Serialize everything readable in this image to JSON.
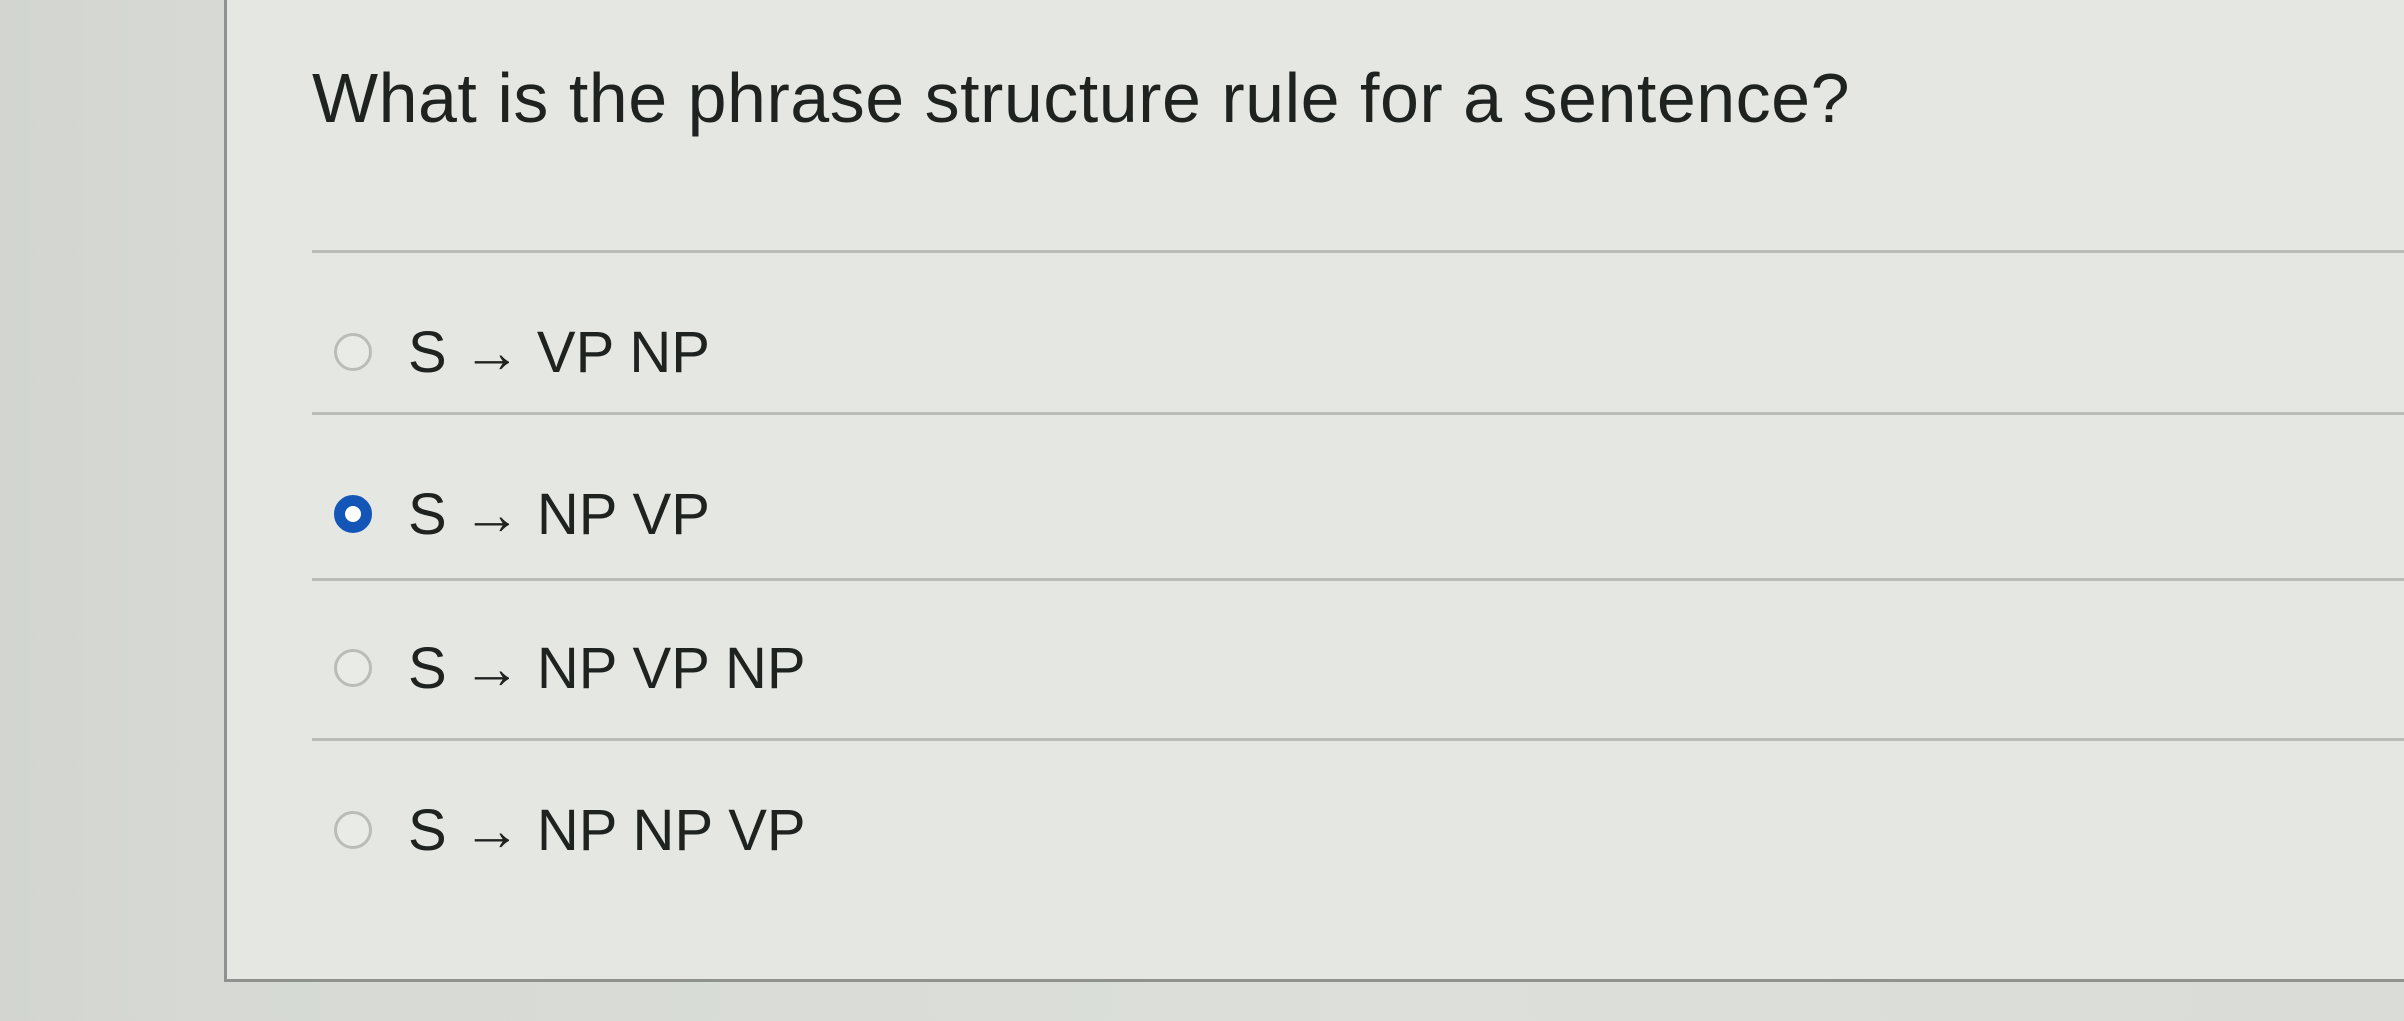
{
  "question": {
    "text": "What is the phrase structure rule for a sentence?"
  },
  "options": [
    {
      "label": "S → VP NP",
      "selected": false
    },
    {
      "label": "S → NP VP",
      "selected": true
    },
    {
      "label": "S → NP VP NP",
      "selected": false
    },
    {
      "label": "S → NP NP VP",
      "selected": false
    }
  ],
  "colors": {
    "selected_radio": "#1456b8",
    "text": "#1f2320",
    "background": "#e4e7e2"
  }
}
